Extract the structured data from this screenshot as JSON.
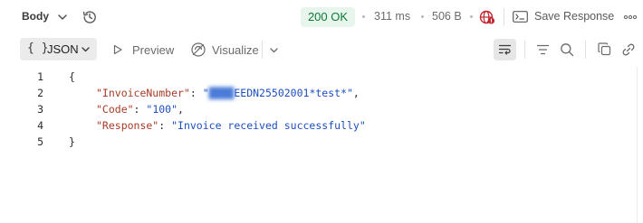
{
  "header": {
    "body_label": "Body",
    "status": "200 OK",
    "time": "311 ms",
    "size": "506 B",
    "save_label": "Save Response"
  },
  "colors": {
    "status_bg": "#e7f5ec",
    "status_text": "#0c7a37",
    "key": "#a83b27",
    "string": "#1d4fbf",
    "network_icon": "#c0262d"
  },
  "toolbar": {
    "format_braces": "{ }",
    "format_label": "JSON",
    "preview_label": "Preview",
    "visualize_label": "Visualize"
  },
  "icons": {
    "body_dropdown": "chevron-down-icon",
    "history": "history-icon",
    "network": "globe-warning-icon",
    "save": "save-response-icon",
    "more": "more-horizontal-icon",
    "preview": "play-icon",
    "visualize": "visualize-icon",
    "wrap": "wrap-lines-icon",
    "filter": "filter-icon",
    "search": "search-icon",
    "copy": "copy-icon",
    "link": "link-icon"
  },
  "response_lines": [
    {
      "num": "1",
      "open": "{"
    },
    {
      "num": "2",
      "key": "\"InvoiceNumber\"",
      "sep": ": ",
      "value_prefix": "\"",
      "value_redacted": "████",
      "value": "EEDN25502001*test*\"",
      "tail": ","
    },
    {
      "num": "3",
      "key": "\"Code\"",
      "sep": ": ",
      "value": "\"100\"",
      "tail": ","
    },
    {
      "num": "4",
      "key": "\"Response\"",
      "sep": ": ",
      "value": "\"Invoice received successfully\"",
      "tail": ""
    },
    {
      "num": "5",
      "open": "}"
    }
  ]
}
